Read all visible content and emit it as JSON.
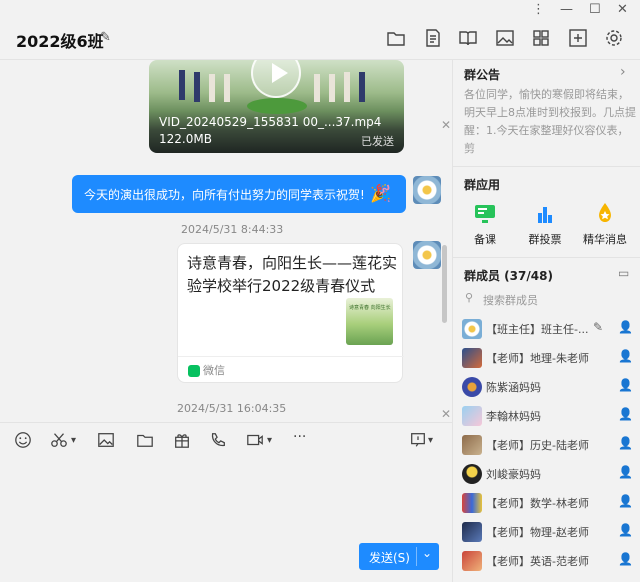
{
  "window": {
    "title": "2022级6班",
    "controls": [
      "⋮",
      "—",
      "☐",
      "✕"
    ]
  },
  "toolbar": {
    "icons": [
      "folder-icon",
      "document-icon",
      "book-icon",
      "image-icon",
      "apps-grid-icon",
      "add-window-icon",
      "gear-icon"
    ]
  },
  "chat": {
    "video": {
      "filename": "VID_20240529_155831 00_...37.mp4",
      "size": "122.0MB",
      "status": "已发送"
    },
    "bubble": {
      "text": "今天的演出很成功，向所有付出努力的同学表示祝贺!",
      "emoji": "🎉"
    },
    "time1": "2024/5/31 8:44:33",
    "link_card": {
      "title": "诗意青春，向阳生长——莲花实验学校举行2022级青春仪式",
      "thumb_text": "诗意青春 向阳生长",
      "source": "微信"
    },
    "time2": "2024/5/31 16:04:35"
  },
  "input_toolbar": {
    "icons": [
      "emoji-icon",
      "scissors-icon",
      "image-icon",
      "folder-icon",
      "gift-icon",
      "phone-icon",
      "video-call-icon",
      "more-icon",
      "history-icon"
    ],
    "more_label": "···",
    "send_label": "发送(S)",
    "send_dropdown": "⌄"
  },
  "right_panel": {
    "announcement": {
      "title": "群公告",
      "text": "各位同学，愉快的寒假即将结束，明天早上8点准时到校报到。几点提醒：1.今天在家整理好仪容仪表，剪"
    },
    "apps": {
      "title": "群应用",
      "items": [
        {
          "label": "备课",
          "icon": "lesson-icon",
          "color": "#27c35a"
        },
        {
          "label": "群投票",
          "icon": "vote-icon",
          "color": "#1e8bff"
        },
        {
          "label": "精华消息",
          "icon": "essence-icon",
          "color": "#f7b500"
        }
      ]
    },
    "members": {
      "title": "群成员 (37/48)",
      "search_placeholder": "搜索群成员",
      "list": [
        {
          "name": "【班主任】班主任-...",
          "role": "owner"
        },
        {
          "name": "【老师】地理-朱老师",
          "role": "member"
        },
        {
          "name": "陈紫涵妈妈",
          "role": "member"
        },
        {
          "name": "李翰林妈妈",
          "role": "member"
        },
        {
          "name": "【老师】历史-陆老师",
          "role": "member"
        },
        {
          "name": "刘峻豪妈妈",
          "role": "member"
        },
        {
          "name": "【老师】数学-林老师",
          "role": "member"
        },
        {
          "name": "【老师】物理-赵老师",
          "role": "member"
        },
        {
          "name": "【老师】英语-范老师",
          "role": "member"
        }
      ]
    }
  }
}
